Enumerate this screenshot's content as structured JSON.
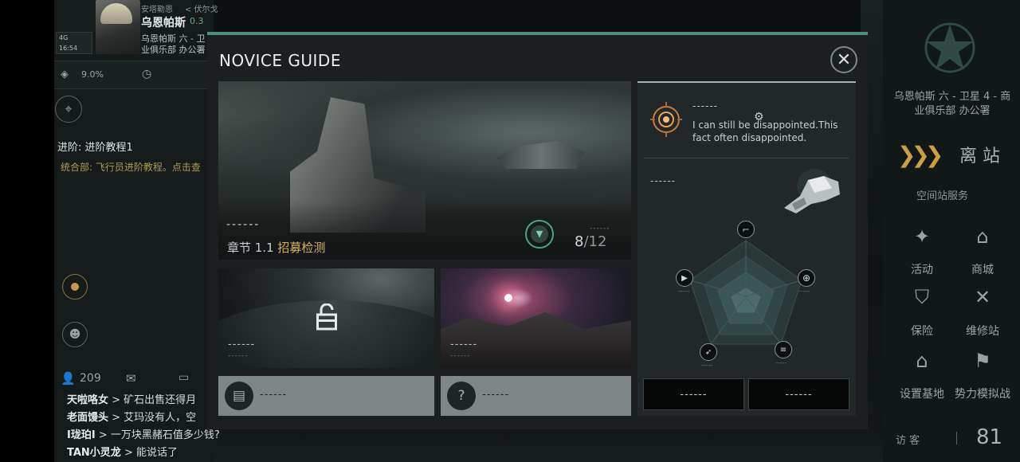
{
  "top_left": {
    "corp_label": "安塔勒恩",
    "region_label": "< 伏尔戈",
    "pilot_name": "乌恩帕斯",
    "security_status": "0.3",
    "location_line1": "乌恩帕斯 六 - 卫",
    "location_line2": "业俱乐部 办公署",
    "signal": "4G",
    "time": "16:54",
    "stat_percent": "9.0%"
  },
  "tutorial": {
    "title": "进阶: 进阶教程1",
    "subtitle": "统合部: 飞行员进阶教程。点击查"
  },
  "chat": {
    "online_count": "209",
    "messages": [
      {
        "user": "天啦咯女",
        "text": " > 矿石出售还得月"
      },
      {
        "user": "老面馒头",
        "text": " > 艾玛没有人，空"
      },
      {
        "user": "I珑珀I",
        "text": " > 一万块黑赭石值多少钱?"
      },
      {
        "user": "TAN小灵龙",
        "text": " > 能说话了"
      }
    ]
  },
  "right_menu": {
    "station_line1": "乌恩帕斯 六 - 卫星 4 - 商",
    "station_line2": "业俱乐部 办公署",
    "undock_label": "离 站",
    "services_label": "空间站服务",
    "items": [
      {
        "label": "活动",
        "icon": "party-popper-icon"
      },
      {
        "label": "商城",
        "icon": "shop-icon"
      },
      {
        "label": "保险",
        "icon": "insurance-icon"
      },
      {
        "label": "维修站",
        "icon": "repair-icon"
      },
      {
        "label": "设置基地",
        "icon": "base-icon"
      },
      {
        "label": "势力模拟战",
        "icon": "flags-icon"
      }
    ],
    "visitors_label": "访 客",
    "visitors_count": "81"
  },
  "modal": {
    "title": "NOVICE GUIDE",
    "hero": {
      "dashes": "------",
      "chapter_prefix": "章节 1.1 ",
      "chapter_name": "招募检测",
      "progress_label": "------",
      "progress_current": "8",
      "progress_max": "/12"
    },
    "cards": [
      {
        "label": "------",
        "sublabel": "------",
        "locked": true
      },
      {
        "label": "------",
        "sublabel": "------",
        "locked": false
      }
    ],
    "buttons": [
      {
        "label": "------",
        "icon": "book-icon"
      },
      {
        "label": "------",
        "icon": "help-icon"
      }
    ],
    "side": {
      "name": "------",
      "quote": "I can still be disappointed.This fact often disappointed.",
      "ship_label": "------",
      "radar_labels": [
        "-----",
        "-----",
        "-----",
        "-----"
      ],
      "stat_buttons": [
        "------",
        "------"
      ]
    }
  }
}
